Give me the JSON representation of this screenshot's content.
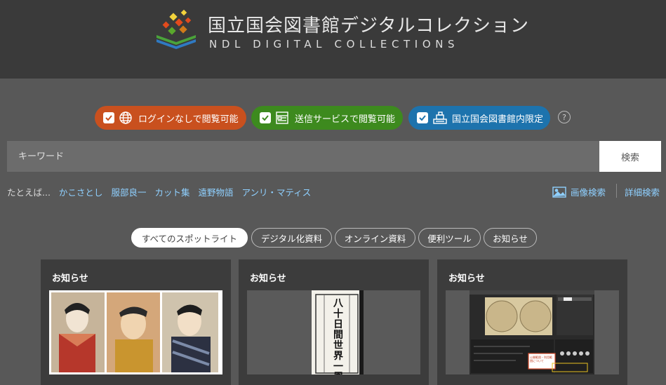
{
  "header": {
    "title_jp": "国立国会図書館デジタルコレクション",
    "title_en": "NDL DIGITAL COLLECTIONS"
  },
  "filters": [
    {
      "label": "ログインなしで閲覧可能",
      "color": "#c9501e",
      "checked": true,
      "icon": "globe-icon"
    },
    {
      "label": "送信サービスで閲覧可能",
      "color": "#3d8a1e",
      "checked": true,
      "icon": "monitor-icon"
    },
    {
      "label": "国立国会図書館内限定",
      "color": "#1d73ad",
      "checked": true,
      "icon": "library-building-icon"
    }
  ],
  "help_label": "?",
  "search": {
    "placeholder": "キーワード",
    "button_label": "検索"
  },
  "examples": {
    "prefix": "たとえば...",
    "links": [
      "かこさとし",
      "服部良一",
      "カット集",
      "遠野物語",
      "アンリ・マティス"
    ]
  },
  "image_search_label": "画像検索",
  "advanced_search_label": "詳細検索",
  "tabs": [
    {
      "label": "すべてのスポットライト",
      "active": true
    },
    {
      "label": "デジタル化資料",
      "active": false
    },
    {
      "label": "オンライン資料",
      "active": false
    },
    {
      "label": "便利ツール",
      "active": false
    },
    {
      "label": "お知らせ",
      "active": false
    }
  ],
  "cards": [
    {
      "title": "お知らせ"
    },
    {
      "title": "お知らせ"
    },
    {
      "title": "お知らせ"
    }
  ],
  "thumb_text": {
    "book_cover": "八十日間世界一周",
    "popup": "公開範囲・利用範囲について"
  }
}
